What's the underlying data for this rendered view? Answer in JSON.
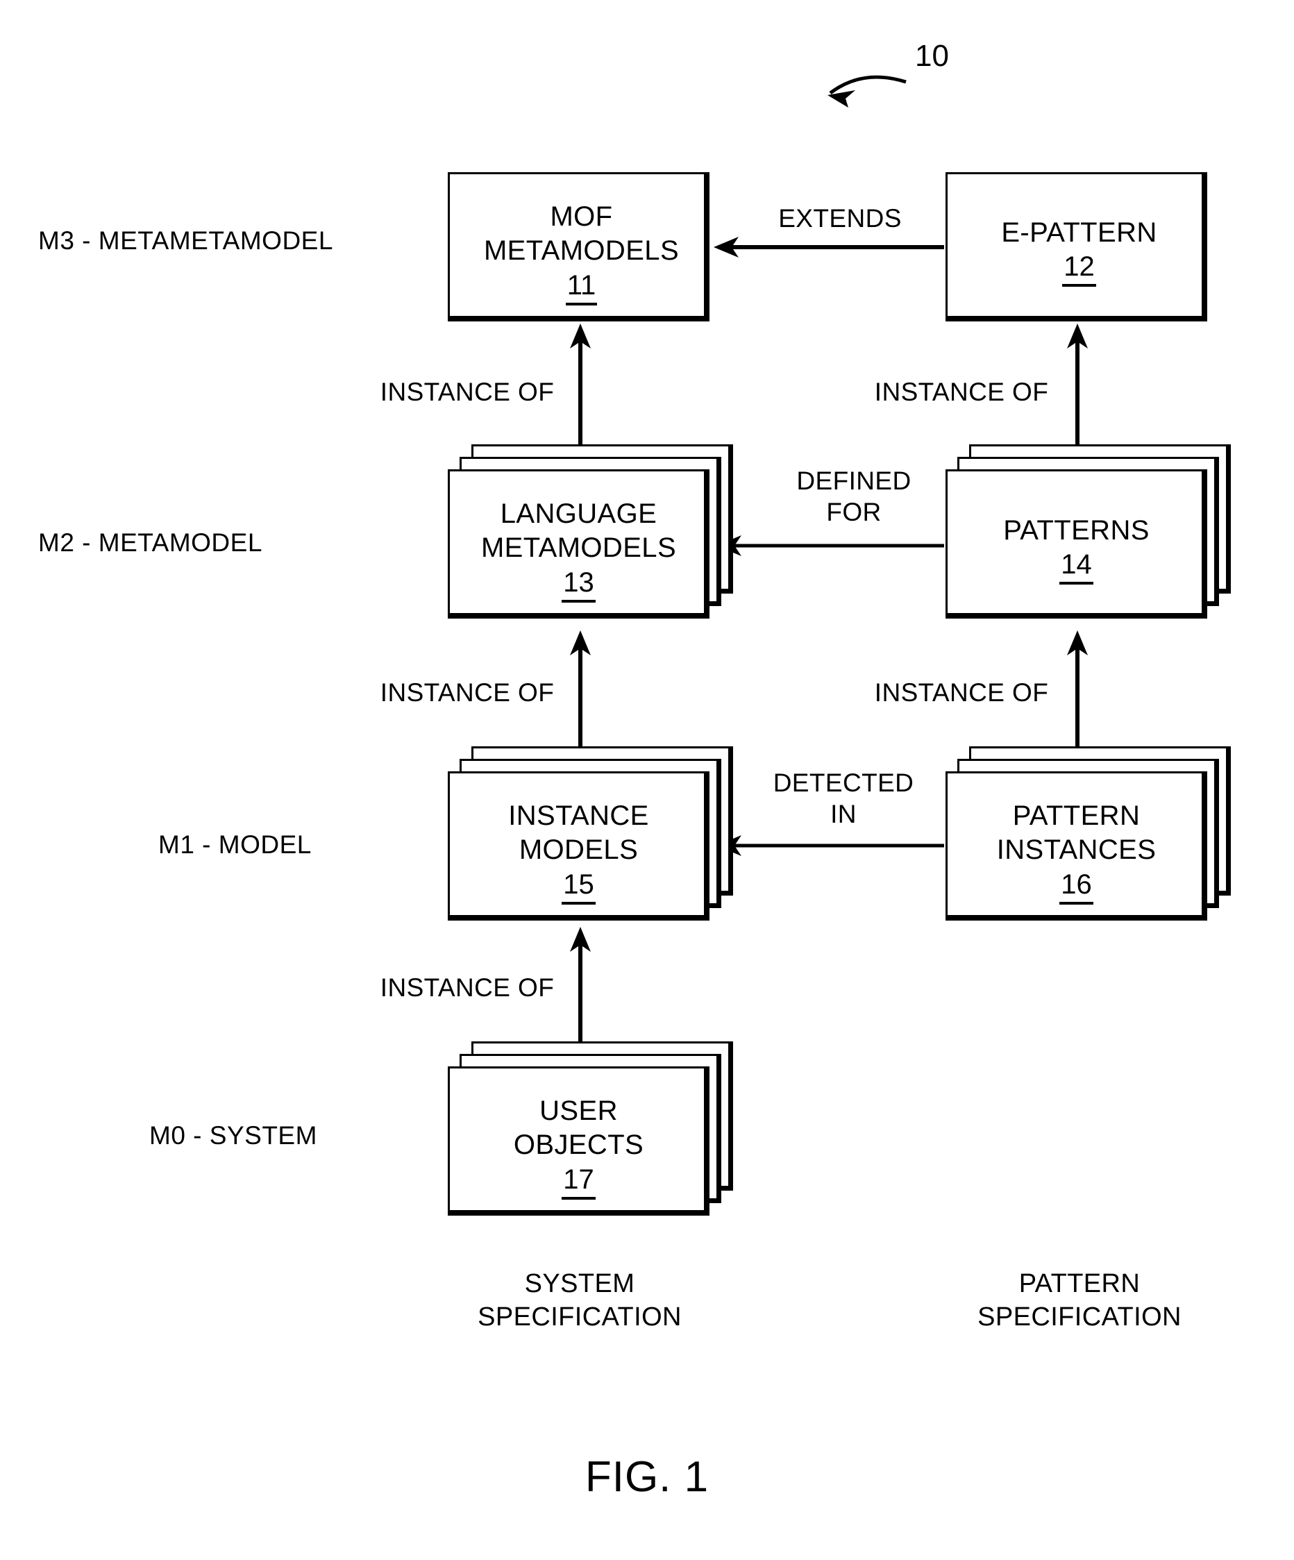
{
  "figure": {
    "caption": "FIG. 1",
    "lead_number": "10"
  },
  "row_labels": [
    {
      "id": "m3",
      "text": "M3 - METAMETAMODEL"
    },
    {
      "id": "m2",
      "text": "M2 - METAMODEL"
    },
    {
      "id": "m1",
      "text": "M1 - MODEL"
    },
    {
      "id": "m0",
      "text": "M0 - SYSTEM"
    }
  ],
  "boxes": {
    "mof_metamodels": {
      "title": "MOF\nMETAMODELS",
      "ref": "11",
      "stacked": false
    },
    "e_pattern": {
      "title": "E-PATTERN",
      "ref": "12",
      "stacked": false
    },
    "language_metamodels": {
      "title": "LANGUAGE\nMETAMODELS",
      "ref": "13",
      "stacked": true
    },
    "patterns": {
      "title": "PATTERNS",
      "ref": "14",
      "stacked": true
    },
    "instance_models": {
      "title": "INSTANCE\nMODELS",
      "ref": "15",
      "stacked": true
    },
    "pattern_instances": {
      "title": "PATTERN\nINSTANCES",
      "ref": "16",
      "stacked": true
    },
    "user_objects": {
      "title": "USER\nOBJECTS",
      "ref": "17",
      "stacked": true
    }
  },
  "connectors": {
    "extends": "EXTENDS",
    "defined_for": "DEFINED\nFOR",
    "detected_in": "DETECTED\nIN",
    "instance_of_left_m3": "INSTANCE OF",
    "instance_of_left_m2": "INSTANCE OF",
    "instance_of_left_m1": "INSTANCE OF",
    "instance_of_right_m3": "INSTANCE OF",
    "instance_of_right_m2": "INSTANCE OF"
  },
  "column_captions": {
    "system": "SYSTEM\nSPECIFICATION",
    "pattern": "PATTERN\nSPECIFICATION"
  },
  "colors": {
    "ink": "#000000",
    "paper": "#ffffff"
  }
}
